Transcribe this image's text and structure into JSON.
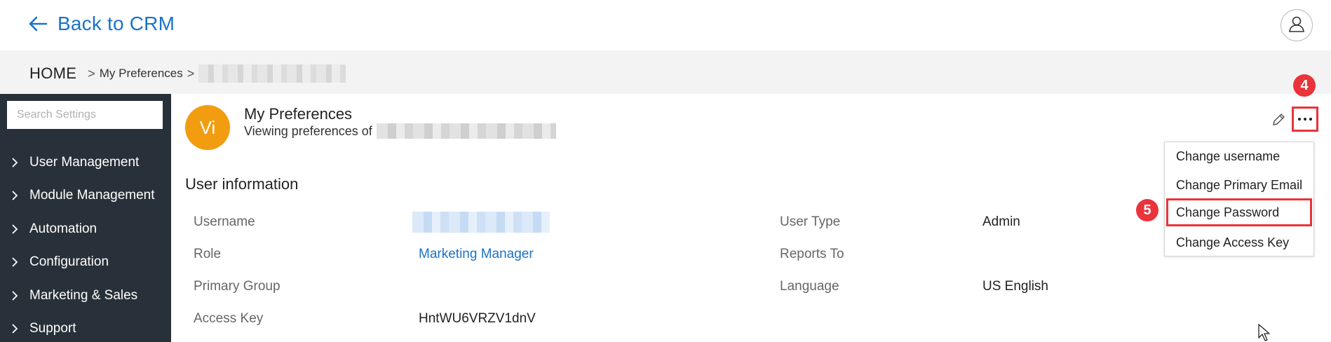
{
  "header": {
    "back_label": "Back to CRM"
  },
  "breadcrumb": {
    "home": "HOME",
    "separator": ">",
    "current": "My Preferences"
  },
  "sidebar": {
    "search_placeholder": "Search Settings",
    "items": [
      {
        "label": "User Management"
      },
      {
        "label": "Module Management"
      },
      {
        "label": "Automation"
      },
      {
        "label": "Configuration"
      },
      {
        "label": "Marketing & Sales"
      },
      {
        "label": "Support"
      }
    ]
  },
  "profile": {
    "avatar_initials": "Vi",
    "title": "My Preferences",
    "subtitle": "Viewing preferences of"
  },
  "user_info": {
    "section_title": "User information",
    "username_label": "Username",
    "role_label": "Role",
    "role_value": "Marketing Manager",
    "primary_group_label": "Primary Group",
    "access_key_label": "Access Key",
    "access_key_value": "HntWU6VRZV1dnV",
    "user_type_label": "User Type",
    "user_type_value": "Admin",
    "reports_to_label": "Reports To",
    "language_label": "Language",
    "language_value": "US English"
  },
  "actions_menu": {
    "items": [
      {
        "label": "Change username"
      },
      {
        "label": "Change Primary Email"
      },
      {
        "label": "Change Password"
      },
      {
        "label": "Change Access Key"
      }
    ]
  },
  "annotations": {
    "step_4": "4",
    "step_5": "5"
  },
  "colors": {
    "accent": "#1a73c9",
    "sidebar_bg": "#283139",
    "avatar_bg": "#f29c0f",
    "annotation_red": "#e8343a"
  }
}
